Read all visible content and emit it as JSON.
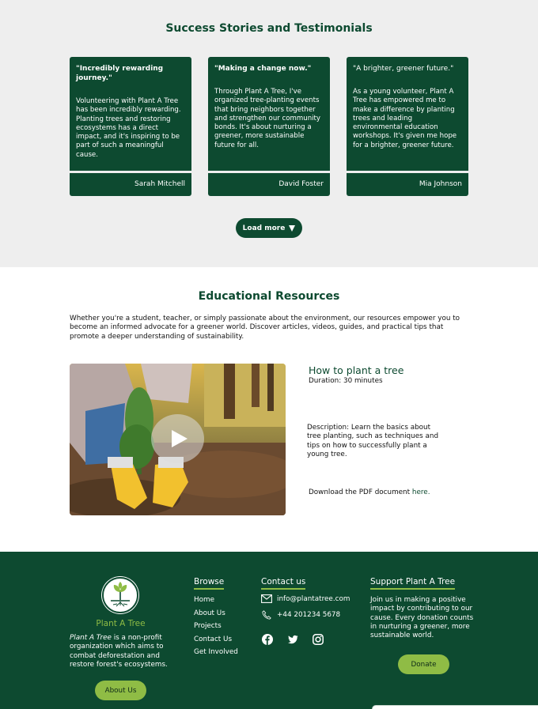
{
  "testimonials": {
    "title": "Success Stories and Testimonials",
    "cards": [
      {
        "quote": "\"Incredibly rewarding journey.\"",
        "text": "Volunteering with Plant A Tree has been incredibly rewarding. Planting trees and restoring ecosystems has a direct impact, and it's inspiring to be part of such a meaningful cause.",
        "author": "Sarah Mitchell"
      },
      {
        "quote": "\"Making a change now.\"",
        "text": "Through Plant A Tree, I've organized tree-planting events that bring neighbors together and strengthen our community bonds. It's about nurturing a greener, more sustainable future for all.",
        "author": "David Foster"
      },
      {
        "quote": "\"A brighter, greener future.\"",
        "text": "As a young volunteer, Plant A Tree has empowered me to make a difference by planting trees and leading environmental education workshops. It's given me hope for a brighter, greener future.",
        "author": "Mia Johnson"
      }
    ],
    "load_more": "Load more",
    "load_more_icon": "triangle-down-icon"
  },
  "education": {
    "title": "Educational Resources",
    "intro": "Whether you're a student, teacher, or simply passionate about the environment, our resources empower you to become an informed advocate for a greener world. Discover articles, videos, guides, and practical tips that promote a deeper understanding of sustainability.",
    "resource": {
      "title": "How to plant a tree",
      "duration": "Duration: 30 minutes",
      "description": "Description: Learn the basics about tree planting, such as techniques and tips on how to successfully plant a young tree.",
      "download_prefix": "Download the PDF document ",
      "download_link": "here."
    }
  },
  "footer": {
    "brand": "Plant A Tree",
    "about_em": "Plant A Tree",
    "about_rest": " is a non-profit organization which aims to combat deforestation and restore forest's ecosystems.",
    "about_button": "About Us",
    "browse": {
      "heading": "Browse",
      "items": [
        "Home",
        "About Us",
        "Projects",
        "Contact Us",
        "Get Involved"
      ]
    },
    "contact": {
      "heading": "Contact us",
      "email": "info@plantatree.com",
      "phone": "+44 201234 5678",
      "social_icons": [
        "facebook-icon",
        "twitter-icon",
        "instagram-icon"
      ]
    },
    "support": {
      "heading": "Support Plant A Tree",
      "text": "Join us in making a positive impact by contributing to our cause. Every donation counts in nurturing a greener, more sustainable world.",
      "button": "Donate"
    }
  },
  "colors": {
    "primary": "#0d4a30",
    "accent": "#8fbc45",
    "section_bg": "#eeeeee"
  }
}
